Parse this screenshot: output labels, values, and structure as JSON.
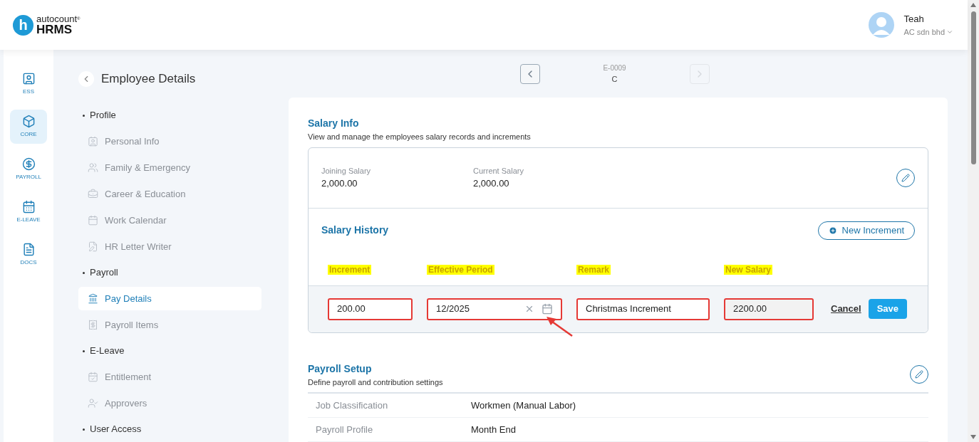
{
  "header": {
    "logo": {
      "mark": "h",
      "brand_small": "autocount",
      "trademark": "®",
      "brand_large": "HRMS"
    },
    "user": {
      "name": "Teah",
      "company": "AC sdn bhd"
    }
  },
  "rail": [
    {
      "label": "ESS",
      "selected": false
    },
    {
      "label": "CORE",
      "selected": true
    },
    {
      "label": "PAYROLL",
      "selected": false
    },
    {
      "label": "E-LEAVE",
      "selected": false
    },
    {
      "label": "DOCS",
      "selected": false
    }
  ],
  "page_title": "Employee Details",
  "subnav": [
    {
      "label": "Profile",
      "children": [
        {
          "label": "Personal Info",
          "selected": false
        },
        {
          "label": "Family & Emergency",
          "selected": false
        },
        {
          "label": "Career & Education",
          "selected": false
        },
        {
          "label": "Work Calendar",
          "selected": false
        },
        {
          "label": "HR Letter Writer",
          "selected": false
        }
      ]
    },
    {
      "label": "Payroll",
      "children": [
        {
          "label": "Pay Details",
          "selected": true
        },
        {
          "label": "Payroll Items",
          "selected": false
        }
      ]
    },
    {
      "label": "E-Leave",
      "children": [
        {
          "label": "Entitlement",
          "selected": false
        },
        {
          "label": "Approvers",
          "selected": false
        }
      ]
    },
    {
      "label": "User Access"
    }
  ],
  "employee_nav": {
    "code": "E-0009",
    "name": "C",
    "prev_disabled": false,
    "next_disabled": true
  },
  "salary_info": {
    "title": "Salary Info",
    "subtitle": "View and manage the employees salary records and increments",
    "summary": [
      {
        "label": "Joining Salary",
        "value": "2,000.00"
      },
      {
        "label": "Current Salary",
        "value": "2,000.00"
      }
    ],
    "history": {
      "title": "Salary History",
      "new_button": "New Increment",
      "columns": [
        {
          "label": "Increment",
          "highlighted": true
        },
        {
          "label": "Effective Period",
          "highlighted": true
        },
        {
          "label": "Remark",
          "highlighted": true
        },
        {
          "label": "New Salary",
          "highlighted": true
        }
      ],
      "fields": [
        {
          "kind": "text",
          "value": "200.00",
          "marked": true
        },
        {
          "kind": "month",
          "value": "12/2025",
          "marked": true,
          "pointer_arrow": true
        },
        {
          "kind": "text",
          "value": "Christmas Increment",
          "marked": true
        },
        {
          "kind": "readonly",
          "value": "2200.00",
          "marked": true
        }
      ],
      "cancel": "Cancel",
      "save": "Save"
    }
  },
  "payroll_setup": {
    "title": "Payroll Setup",
    "subtitle": "Define payroll and contribution settings",
    "rows": [
      {
        "label": "Job Classification",
        "value": "Workmen (Manual Labor)"
      },
      {
        "label": "Payroll Profile",
        "value": "Month End"
      }
    ]
  }
}
